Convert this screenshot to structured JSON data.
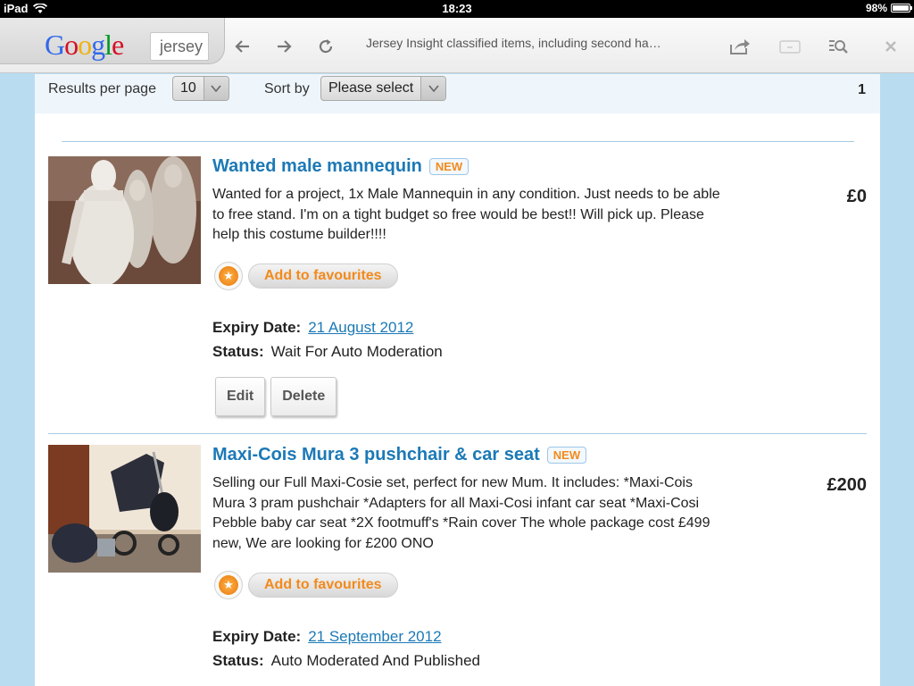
{
  "status_bar": {
    "device": "iPad",
    "time": "18:23",
    "battery": "98%",
    "battery_level": 0.98
  },
  "toolbar": {
    "search_value": "jersey",
    "page_title": "Jersey Insight classified items, including second ha…",
    "logo_letters": [
      {
        "ch": "G",
        "color": "#3369e8"
      },
      {
        "ch": "o",
        "color": "#d50f25"
      },
      {
        "ch": "o",
        "color": "#eeb211"
      },
      {
        "ch": "g",
        "color": "#3369e8"
      },
      {
        "ch": "l",
        "color": "#009925"
      },
      {
        "ch": "e",
        "color": "#d50f25"
      }
    ],
    "icons": [
      "back-arrow-icon",
      "forward-arrow-icon",
      "reload-icon",
      "share-icon",
      "tabs-icon",
      "search-page-icon",
      "close-icon"
    ]
  },
  "filters": {
    "results_label": "Results per page",
    "results_value": "10",
    "sort_label": "Sort by",
    "sort_value": "Please select",
    "page_number": "1"
  },
  "listings": [
    {
      "title": "Wanted male mannequin",
      "badge": "NEW",
      "description": "Wanted for a project, 1x Male Mannequin in any condition. Just needs to be able to free stand. I'm on a tight budget so free would be best!! Will pick up. Please help this costume builder!!!!",
      "price": "£0",
      "fav_label": "Add to favourites",
      "expiry_label": "Expiry Date:",
      "expiry_value": "21 August 2012",
      "status_label": "Status:",
      "status_value": "Wait For Auto Moderation",
      "edit_label": "Edit",
      "delete_label": "Delete"
    },
    {
      "title": "Maxi-Cois Mura 3 pushchair & car seat",
      "badge": "NEW",
      "description": "Selling our Full Maxi-Cosie set, perfect for new Mum. It includes: *Maxi-Cois Mura 3 pram pushchair *Adapters for all Maxi-Cosi infant car seat *Maxi-Cosi Pebble baby car seat *2X footmuff's *Rain cover The whole package cost £499 new, We are looking for £200 ONO",
      "price": "£200",
      "fav_label": "Add to favourites",
      "expiry_label": "Expiry Date:",
      "expiry_value": "21 September 2012",
      "status_label": "Status:",
      "status_value": "Auto Moderated And Published"
    }
  ]
}
